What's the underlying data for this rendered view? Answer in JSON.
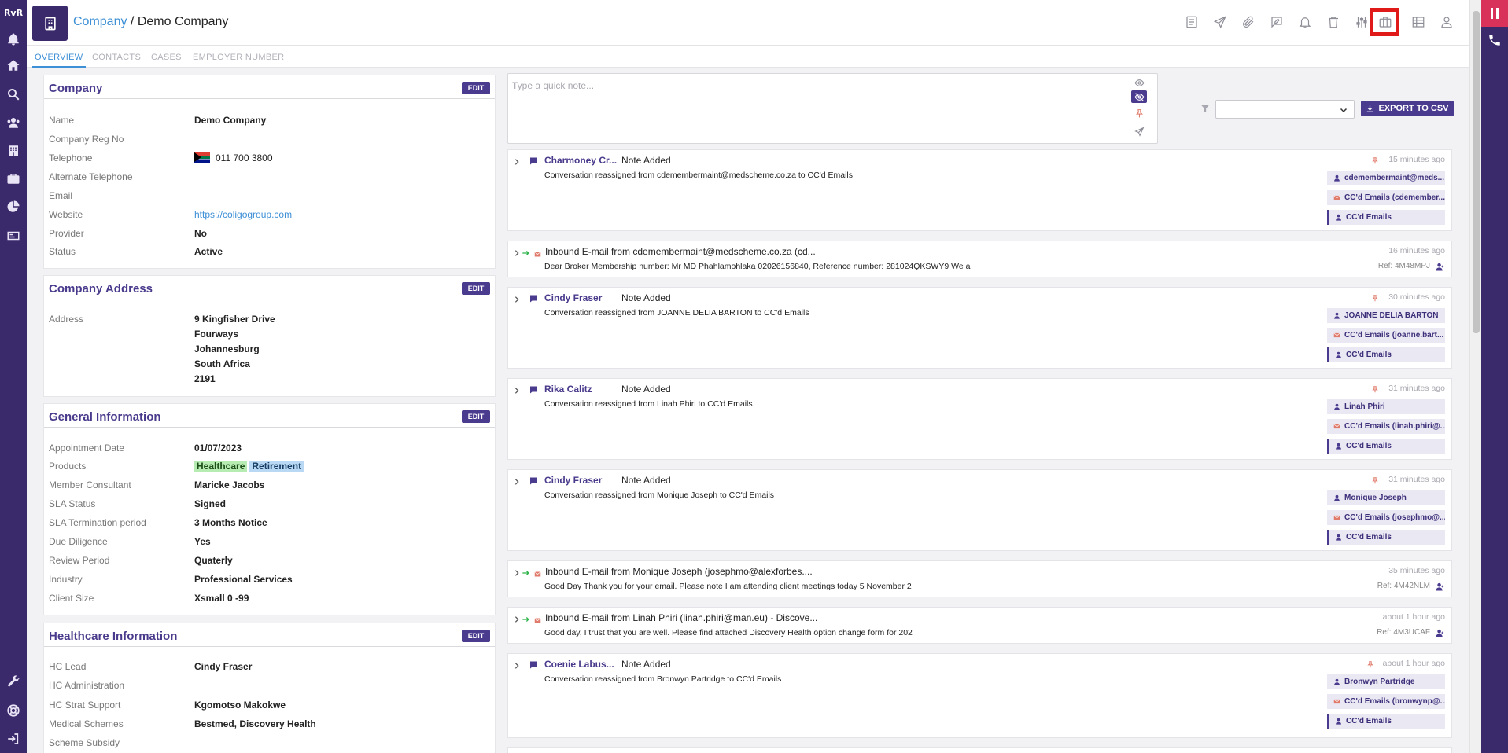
{
  "nav": {
    "brand": "RvR"
  },
  "header": {
    "breadcrumb_root": "Company",
    "breadcrumb_sep": " / ",
    "breadcrumb_current": "Demo Company"
  },
  "tabs": [
    "OVERVIEW",
    "CONTACTS",
    "CASES",
    "EMPLOYER NUMBER"
  ],
  "company": {
    "title": "Company",
    "edit": "EDIT",
    "fields": [
      {
        "label": "Name",
        "value": "Demo Company"
      },
      {
        "label": "Company Reg No",
        "value": ""
      },
      {
        "label": "Telephone",
        "value": "011 700 3800"
      },
      {
        "label": "Alternate Telephone",
        "value": ""
      },
      {
        "label": "Email",
        "value": ""
      },
      {
        "label": "Website",
        "value": "https://coligogroup.com"
      },
      {
        "label": "Provider",
        "value": "No"
      },
      {
        "label": "Status",
        "value": "Active"
      }
    ]
  },
  "address": {
    "title": "Company Address",
    "edit": "EDIT",
    "label": "Address",
    "lines": [
      "9 Kingfisher Drive",
      "Fourways",
      "Johannesburg",
      "South Africa",
      "2191"
    ]
  },
  "general": {
    "title": "General Information",
    "edit": "EDIT",
    "fields": [
      {
        "label": "Appointment Date",
        "value": "01/07/2023"
      },
      {
        "label": "Products",
        "value": ""
      },
      {
        "label": "Member Consultant",
        "value": "Maricke Jacobs"
      },
      {
        "label": "SLA Status",
        "value": "Signed"
      },
      {
        "label": "SLA Termination period",
        "value": "3 Months Notice"
      },
      {
        "label": "Due Diligence",
        "value": "Yes"
      },
      {
        "label": "Review Period",
        "value": "Quaterly"
      },
      {
        "label": "Industry",
        "value": "Professional Services"
      },
      {
        "label": "Client Size",
        "value": "Xsmall 0 -99"
      }
    ],
    "products": [
      "Healthcare",
      "Retirement"
    ]
  },
  "healthcare": {
    "title": "Healthcare Information",
    "edit": "EDIT",
    "fields": [
      {
        "label": "HC Lead",
        "value": "Cindy Fraser"
      },
      {
        "label": "HC Administration",
        "value": ""
      },
      {
        "label": "HC Strat Support",
        "value": "Kgomotso Makokwe"
      },
      {
        "label": "Medical Schemes",
        "value": "Bestmed, Discovery Health"
      },
      {
        "label": "Scheme Subsidy",
        "value": ""
      }
    ]
  },
  "note": {
    "placeholder": "Type a quick note..."
  },
  "toolbar": {
    "export_label": "EXPORT TO CSV",
    "filter_value": ""
  },
  "feed": [
    {
      "kind": "note",
      "author": "Charmoney Cr...",
      "type": "Note Added",
      "body": "Conversation reassigned from cdemembermaint@medscheme.co.za to CC'd Emails",
      "time": "15 minutes ago",
      "chips": [
        {
          "icon": "user",
          "text": "cdemembermaint@meds..."
        },
        {
          "icon": "mail",
          "text": "CC'd Emails (cdemember..."
        },
        {
          "icon": "user",
          "text": "CC'd Emails"
        }
      ]
    },
    {
      "kind": "email",
      "title": "Inbound E-mail from cdemembermaint@medscheme.co.za (cd...",
      "body": "Dear Broker Membership number: Mr MD Phahlamohlaka 02026156840, Reference number: 281024QKSWY9 We a",
      "time": "16 minutes ago",
      "ref": "Ref: 4M48MPJ"
    },
    {
      "kind": "note",
      "author": "Cindy Fraser",
      "type": "Note Added",
      "body": "Conversation reassigned from JOANNE DELIA BARTON to CC'd Emails",
      "time": "30 minutes ago",
      "chips": [
        {
          "icon": "user",
          "text": "JOANNE DELIA BARTON"
        },
        {
          "icon": "mail",
          "text": "CC'd Emails (joanne.bart..."
        },
        {
          "icon": "user",
          "text": "CC'd Emails"
        }
      ]
    },
    {
      "kind": "note",
      "author": "Rika Calitz",
      "type": "Note Added",
      "body": "Conversation reassigned from Linah Phiri to CC'd Emails",
      "time": "31 minutes ago",
      "chips": [
        {
          "icon": "user",
          "text": "Linah Phiri"
        },
        {
          "icon": "mail",
          "text": "CC'd Emails (linah.phiri@..."
        },
        {
          "icon": "user",
          "text": "CC'd Emails"
        }
      ]
    },
    {
      "kind": "note",
      "author": "Cindy Fraser",
      "type": "Note Added",
      "body": "Conversation reassigned from Monique Joseph to CC'd Emails",
      "time": "31 minutes ago",
      "chips": [
        {
          "icon": "user",
          "text": "Monique Joseph"
        },
        {
          "icon": "mail",
          "text": "CC'd Emails (josephmo@..."
        },
        {
          "icon": "user",
          "text": "CC'd Emails"
        }
      ]
    },
    {
      "kind": "email",
      "title": "Inbound E-mail from Monique Joseph (josephmo@alexforbes....",
      "body": "Good Day   Thank you for your email. Please note I am attending client meetings today 5 November 2",
      "time": "35 minutes ago",
      "ref": "Ref: 4M42NLM"
    },
    {
      "kind": "email",
      "title": "Inbound E-mail from Linah Phiri (linah.phiri@man.eu) - Discove...",
      "body": "Good day, I trust that you are well. Please find attached Discovery Health option change form for 202",
      "time": "about 1 hour ago",
      "ref": "Ref: 4M3UCAF"
    },
    {
      "kind": "note",
      "author": "Coenie Labus...",
      "type": "Note Added",
      "body": "Conversation reassigned from Bronwyn Partridge to CC'd Emails",
      "time": "about 1 hour ago",
      "chips": [
        {
          "icon": "user",
          "text": "Bronwyn Partridge"
        },
        {
          "icon": "mail",
          "text": "CC'd Emails (bronwynp@..."
        },
        {
          "icon": "user",
          "text": "CC'd Emails"
        }
      ]
    }
  ]
}
